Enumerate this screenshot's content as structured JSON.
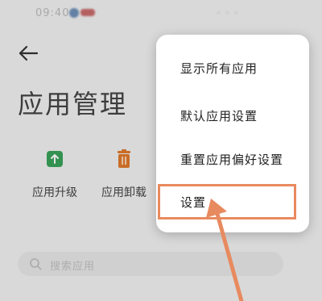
{
  "status_bar": {
    "time": "09:40",
    "right": "◦ ◦ ◦"
  },
  "page": {
    "title": "应用管理"
  },
  "quick_actions": [
    {
      "label": "应用升级",
      "icon": "upgrade-icon",
      "color": "#3aa35b"
    },
    {
      "label": "应用卸载",
      "icon": "trash-icon",
      "color": "#e07a2c"
    }
  ],
  "search": {
    "placeholder": "搜索应用"
  },
  "menu": {
    "items": [
      {
        "label": "显示所有应用"
      },
      {
        "label": "默认应用设置"
      },
      {
        "label": "重置应用偏好设置"
      },
      {
        "label": "设置"
      }
    ]
  },
  "colors": {
    "accent": "#e88a5f",
    "green": "#3aa35b",
    "orange": "#e07a2c"
  }
}
